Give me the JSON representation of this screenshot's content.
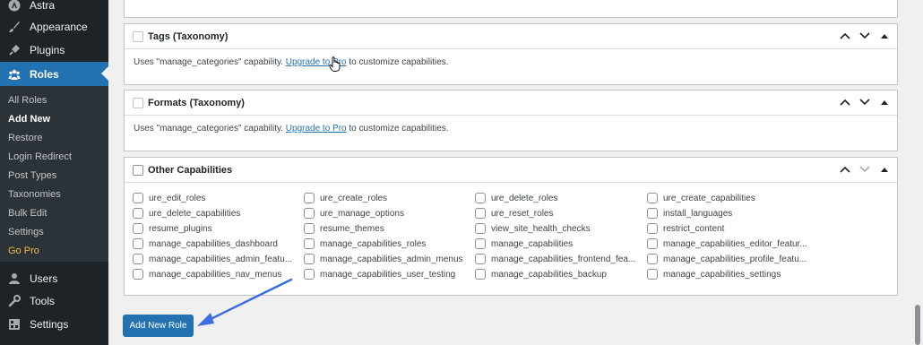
{
  "sidebar": {
    "items": [
      {
        "label": "Astra",
        "icon": "astra-icon"
      },
      {
        "label": "Appearance",
        "icon": "paintbrush-icon"
      },
      {
        "label": "Plugins",
        "icon": "plug-icon"
      },
      {
        "label": "Roles",
        "icon": "users-group-icon"
      },
      {
        "label": "Users",
        "icon": "user-icon"
      },
      {
        "label": "Tools",
        "icon": "wrench-icon"
      },
      {
        "label": "Settings",
        "icon": "settings-icon"
      }
    ],
    "submenu": [
      "All Roles",
      "Add New",
      "Restore",
      "Login Redirect",
      "Post Types",
      "Taxonomies",
      "Bulk Edit",
      "Settings",
      "Go Pro"
    ]
  },
  "panels": {
    "tags": {
      "title": "Tags (Taxonomy)",
      "text_before": "Uses \"manage_categories\" capability. ",
      "link": "Upgrade to Pro",
      "text_after": " to customize capabilities."
    },
    "formats": {
      "title": "Formats (Taxonomy)",
      "text_before": "Uses \"manage_categories\" capability. ",
      "link": "Upgrade to Pro",
      "text_after": " to customize capabilities."
    },
    "other": {
      "title": "Other Capabilities",
      "capabilities": [
        [
          "ure_edit_roles",
          "ure_create_roles",
          "ure_delete_roles",
          "ure_create_capabilities"
        ],
        [
          "ure_delete_capabilities",
          "ure_manage_options",
          "ure_reset_roles",
          "install_languages"
        ],
        [
          "resume_plugins",
          "resume_themes",
          "view_site_health_checks",
          "restrict_content"
        ],
        [
          "manage_capabilities_dashboard",
          "manage_capabilities_roles",
          "manage_capabilities",
          "manage_capabilities_editor_featur..."
        ],
        [
          "manage_capabilities_admin_featu...",
          "manage_capabilities_admin_menus",
          "manage_capabilities_frontend_fea...",
          "manage_capabilities_profile_featu..."
        ],
        [
          "manage_capabilities_nav_menus",
          "manage_capabilities_user_testing",
          "manage_capabilities_backup",
          "manage_capabilities_settings"
        ]
      ]
    }
  },
  "buttons": {
    "add_role": "Add New Role"
  },
  "colors": {
    "primary": "#2271b1",
    "sidebar_bg": "#1d2327",
    "submenu_bg": "#2c3338",
    "annotation_arrow": "#3b6fe0"
  }
}
